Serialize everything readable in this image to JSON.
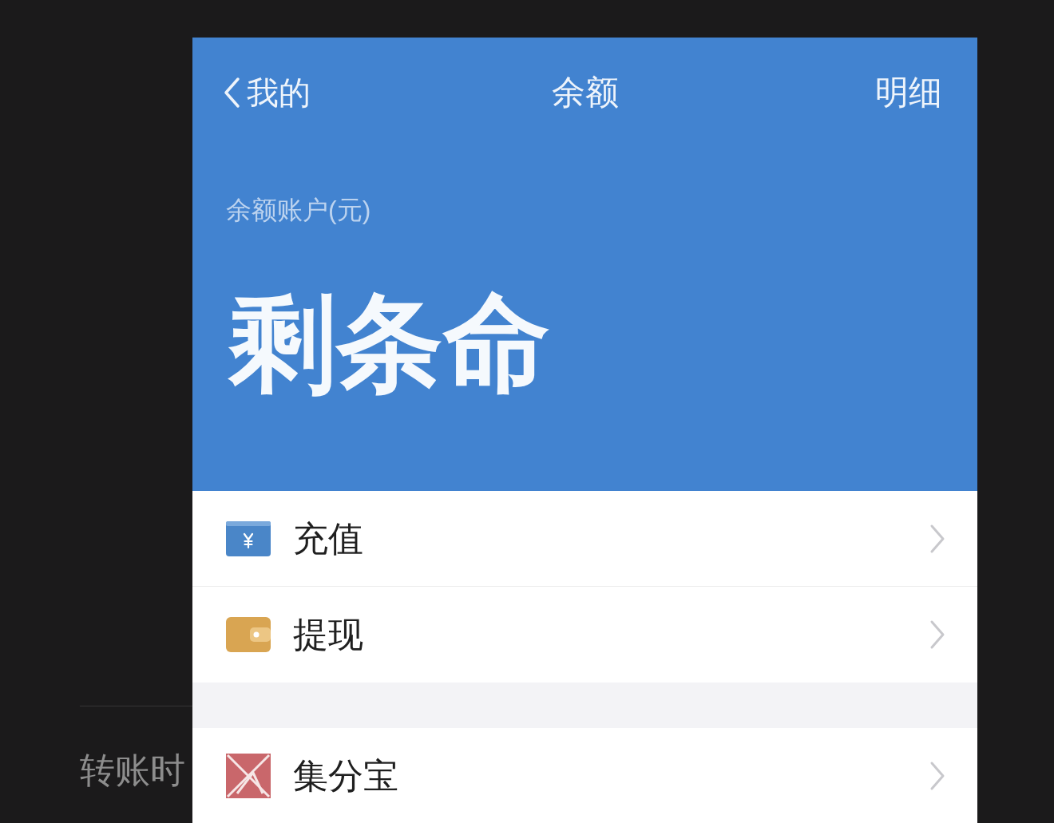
{
  "background_article": {
    "lines": [
      {
        "text": "转账时"
      }
    ]
  },
  "phone": {
    "nav": {
      "back_label": "我的",
      "title": "余额",
      "action": "明细"
    },
    "balance": {
      "label": "余额账户(元)",
      "amount": "剩条命"
    },
    "sections": [
      {
        "items": [
          {
            "kind": "card",
            "label": "充值"
          },
          {
            "kind": "wallet",
            "label": "提现"
          }
        ]
      },
      {
        "items": [
          {
            "kind": "points",
            "label": "集分宝"
          }
        ]
      }
    ]
  }
}
